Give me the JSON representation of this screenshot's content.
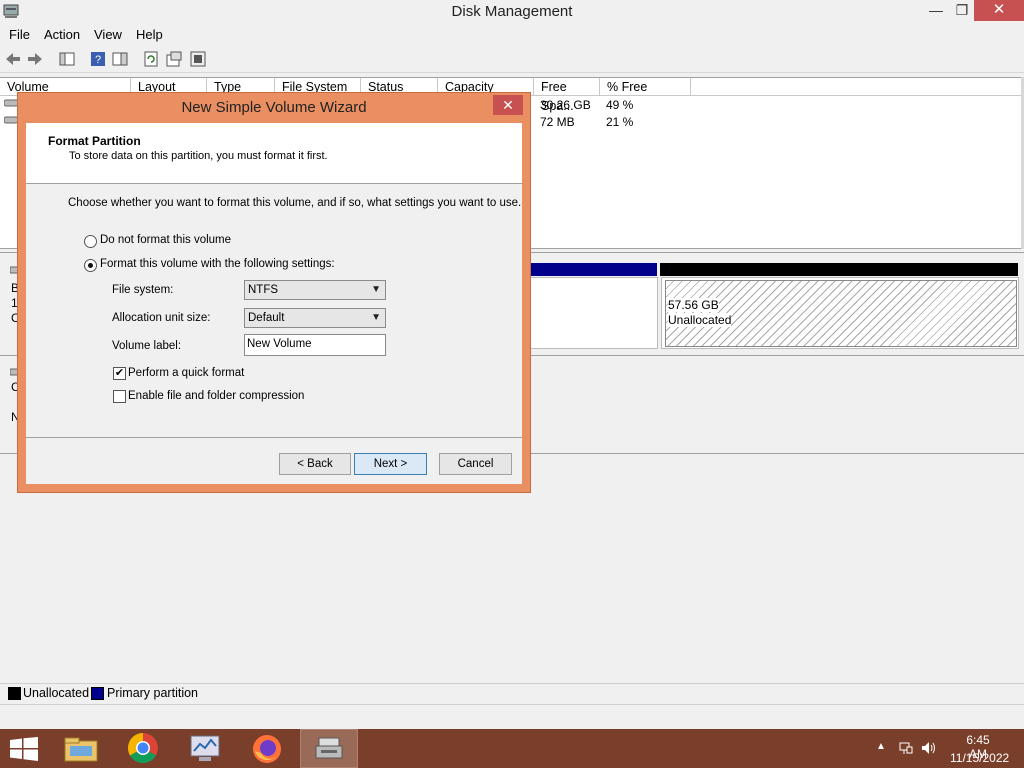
{
  "window": {
    "title": "Disk Management",
    "minimize_glyph": "—",
    "restore_glyph": "❐",
    "close_glyph": "✕"
  },
  "menu": [
    "File",
    "Action",
    "View",
    "Help"
  ],
  "toolbar_icons": [
    "back-icon",
    "forward-icon",
    "console-tree-icon",
    "help-icon",
    "action-pane-icon",
    "refresh-icon",
    "properties-icon",
    "settings-icon"
  ],
  "volume_list": {
    "columns": [
      "Volume",
      "Layout",
      "Type",
      "File System",
      "Status",
      "Capacity",
      "Free Spa...",
      "% Free"
    ],
    "rows": [
      {
        "free_space": "30.26 GB",
        "percent_free": "49 %"
      },
      {
        "free_space": "72 MB",
        "percent_free": "21 %"
      }
    ]
  },
  "disk_pane": {
    "left_fragments": [
      "B",
      "1",
      "C",
      "C",
      "N"
    ],
    "unallocated_size": "57.56 GB",
    "unallocated_label": "Unallocated"
  },
  "legend": {
    "items": [
      {
        "label": "Unallocated",
        "color": "#000000"
      },
      {
        "label": "Primary partition",
        "color": "#00008b"
      }
    ]
  },
  "dialog": {
    "title": "New Simple Volume Wizard",
    "close_glyph": "✕",
    "header_title": "Format Partition",
    "header_subtitle": "To store data on this partition, you must format it first.",
    "instruction": "Choose whether you want to format this volume, and if so, what settings you want to use.",
    "option_no_format": "Do not format this volume",
    "option_format": "Format this volume with the following settings:",
    "selected_option": "format",
    "file_system_label": "File system:",
    "file_system_value": "NTFS",
    "allocation_label": "Allocation unit size:",
    "allocation_value": "Default",
    "volume_label_label": "Volume label:",
    "volume_label_value": "New Volume",
    "quick_format_label": "Perform a quick format",
    "quick_format_checked": true,
    "compression_label": "Enable file and folder compression",
    "compression_checked": false,
    "back_button": "< Back",
    "next_button": "Next >",
    "cancel_button": "Cancel"
  },
  "taskbar": {
    "apps": [
      "file-explorer-icon",
      "chrome-icon",
      "performance-monitor-icon",
      "firefox-icon",
      "disk-management-icon"
    ],
    "time": "6:45 AM",
    "date": "11/15/2022"
  }
}
